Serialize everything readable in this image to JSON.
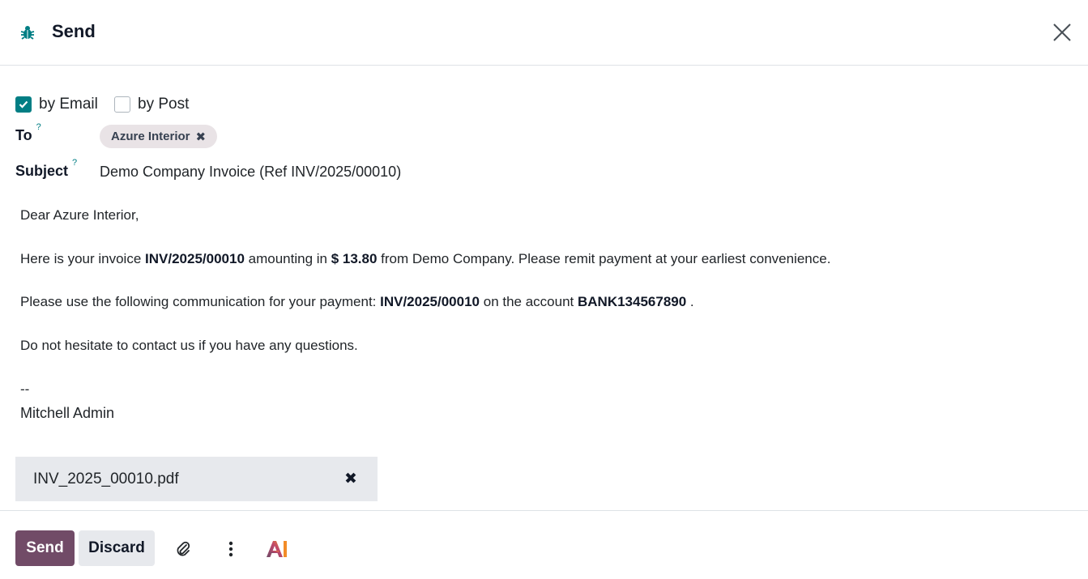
{
  "dialog": {
    "title": "Send"
  },
  "send_options": {
    "email_label": "by Email",
    "email_checked": true,
    "post_label": "by Post",
    "post_checked": false
  },
  "recipients": {
    "label": "To",
    "help": "?",
    "tags": [
      "Azure Interior"
    ]
  },
  "subject": {
    "label": "Subject",
    "help": "?",
    "value": "Demo Company Invoice (Ref INV/2025/00010)"
  },
  "body": {
    "greeting": "Dear Azure Interior,",
    "p1_a": "Here is your invoice ",
    "p1_invoice": "INV/2025/00010",
    "p1_b": " amounting in ",
    "p1_amount": "$ 13.80",
    "p1_c": " from Demo Company. Please remit payment at your earliest convenience.",
    "p2_a": "Please use the following communication for your payment: ",
    "p2_ref": "INV/2025/00010",
    "p2_b": " on the account ",
    "p2_account": "BANK134567890",
    "p2_c": " .",
    "p3": "Do not hesitate to contact us if you have any questions.",
    "sig_sep": "--",
    "signature": "Mitchell Admin"
  },
  "attachment": {
    "filename": "INV_2025_00010.pdf"
  },
  "footer": {
    "send_label": "Send",
    "discard_label": "Discard",
    "ai_label": "AI"
  },
  "colors": {
    "primary": "#714b67",
    "checkbox": "#017e84",
    "tag_bg": "#e9e3e6",
    "secondary_bg": "#e7e9ed"
  },
  "icons": {
    "header": "bug-icon",
    "close": "close-icon",
    "tag_remove": "times-icon",
    "attachment_remove": "times-icon",
    "attach": "paperclip-icon",
    "more": "kebab-icon",
    "ai": "ai-icon"
  }
}
